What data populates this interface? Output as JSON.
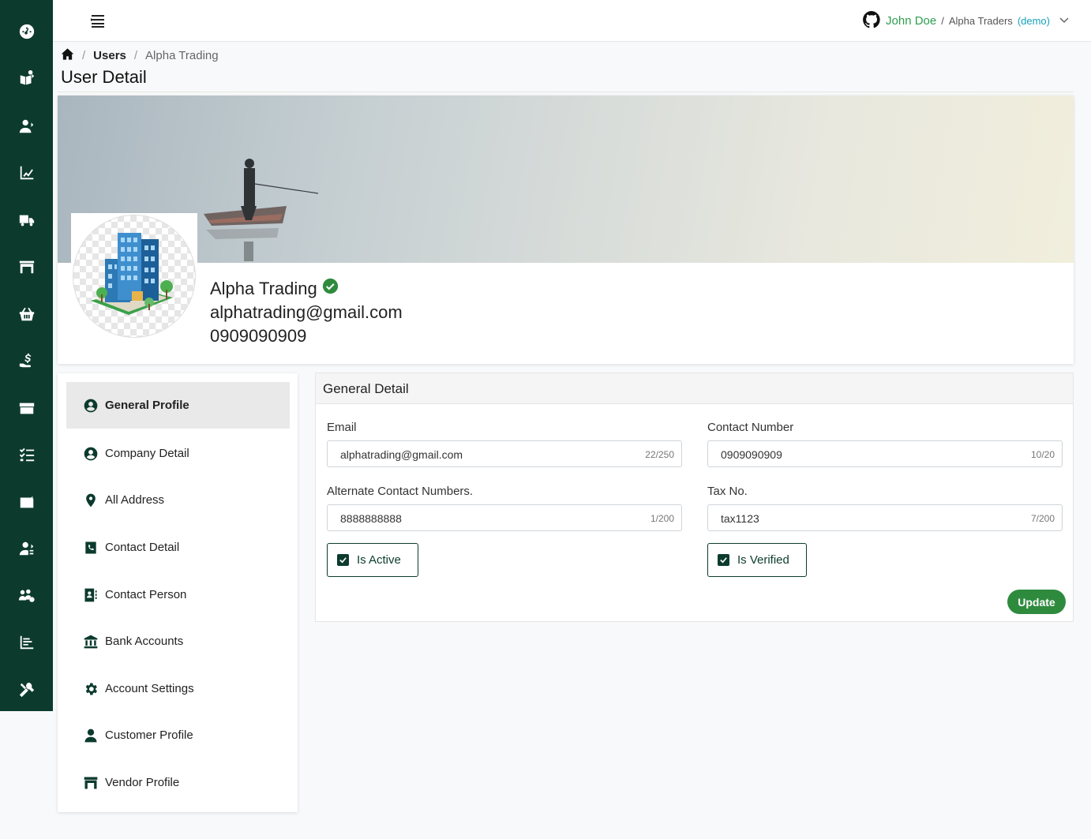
{
  "sidebar": {
    "icons": [
      "dashboard-icon",
      "catalog-icon",
      "user-add-icon",
      "analytics-icon",
      "truck-icon",
      "store-icon",
      "basket-icon",
      "payment-hand-icon",
      "inventory-box-icon",
      "task-list-icon",
      "wallet-icon",
      "user-settings-icon",
      "users-group-icon",
      "report-icon",
      "tools-icon"
    ]
  },
  "header": {
    "user_name": "John Doe",
    "separator": "/",
    "org_name": "Alpha Traders",
    "org_tag": "(demo)"
  },
  "breadcrumb": {
    "sep1": "/",
    "users": "Users",
    "sep2": "/",
    "current": "Alpha Trading"
  },
  "page": {
    "title": "User Detail"
  },
  "profile": {
    "name": "Alpha Trading",
    "email": "alphatrading@gmail.com",
    "phone": "0909090909"
  },
  "menu": [
    {
      "label": "General Profile",
      "icon": "user-circle-icon"
    },
    {
      "label": "Company Detail",
      "icon": "user-circle-icon"
    },
    {
      "label": "All Address",
      "icon": "map-pin-icon"
    },
    {
      "label": "Contact Detail",
      "icon": "phone-book-icon"
    },
    {
      "label": "Contact Person",
      "icon": "contact-card-icon"
    },
    {
      "label": "Bank Accounts",
      "icon": "bank-icon"
    },
    {
      "label": "Account Settings",
      "icon": "gear-icon"
    },
    {
      "label": "Customer Profile",
      "icon": "person-icon"
    },
    {
      "label": "Vendor Profile",
      "icon": "storefront-icon"
    }
  ],
  "detail": {
    "heading": "General Detail",
    "email_label": "Email",
    "email_value": "alphatrading@gmail.com",
    "email_count": "22/250",
    "contact_label": "Contact Number",
    "contact_value": "0909090909",
    "contact_count": "10/20",
    "alt_label": "Alternate Contact Numbers.",
    "alt_value": "8888888888",
    "alt_count": "1/200",
    "tax_label": "Tax No.",
    "tax_value": "tax1123",
    "tax_count": "7/200",
    "active_label": "Is Active",
    "verified_label": "Is Verified",
    "update_label": "Update"
  },
  "colors": {
    "sidebar": "#0c3b2e",
    "accent_green": "#2e8b3e",
    "user_name": "#2e9e4f",
    "demo_tag": "#17a2b8"
  }
}
